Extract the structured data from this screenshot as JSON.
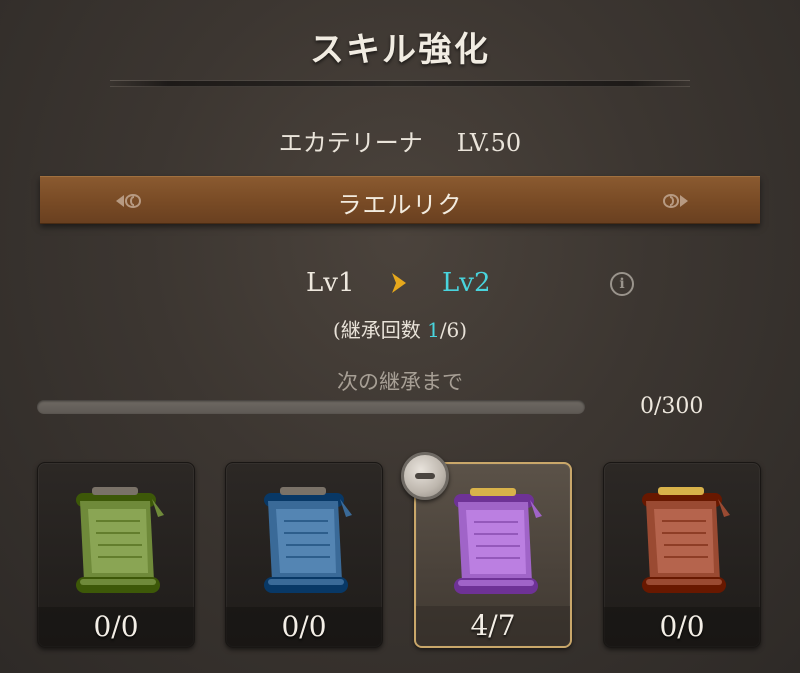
{
  "header": {
    "title": "スキル強化"
  },
  "hero": {
    "name": "エカテリーナ",
    "level": "LV.50"
  },
  "skill": {
    "name": "ラエルリク",
    "prev_icon": "left-scroll-arrow-icon",
    "next_icon": "right-scroll-arrow-icon"
  },
  "upgrade": {
    "from": "Lv1",
    "to": "Lv2",
    "arrow_icon": "chevron-right-icon",
    "info_icon": "info-icon",
    "inherit_prefix": "(継承回数 ",
    "inherit_current": "1",
    "inherit_suffix": "/6)"
  },
  "progress": {
    "label": "次の継承まで",
    "text": "0/300",
    "fraction": 0
  },
  "materials": [
    {
      "name": "green-scroll",
      "color": "#6f8a3a",
      "count": "0/0",
      "selected": false
    },
    {
      "name": "blue-scroll",
      "color": "#3a6a98",
      "count": "0/0",
      "selected": false
    },
    {
      "name": "purple-scroll",
      "color": "#a064c8",
      "count": "4/7",
      "selected": true
    },
    {
      "name": "red-scroll",
      "color": "#9a4a32",
      "count": "0/0",
      "selected": false
    }
  ],
  "colors": {
    "accent_cyan": "#49d4dd",
    "arrow_gold": "#e6a81c",
    "skill_bar": "#7a4c26"
  }
}
